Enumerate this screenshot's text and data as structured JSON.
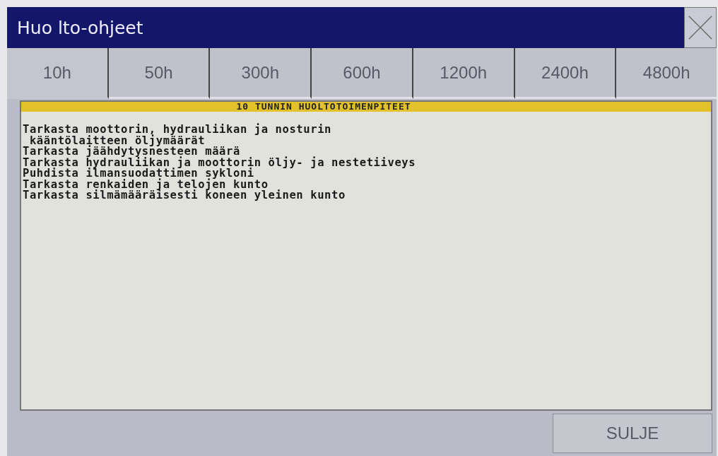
{
  "window": {
    "title": "Huo lto-ohjeet"
  },
  "tabs": [
    {
      "label": "10h",
      "selected": true
    },
    {
      "label": "50h",
      "selected": false
    },
    {
      "label": "300h",
      "selected": false
    },
    {
      "label": "600h",
      "selected": false
    },
    {
      "label": "1200h",
      "selected": false
    },
    {
      "label": "2400h",
      "selected": false
    },
    {
      "label": "4800h",
      "selected": false
    }
  ],
  "panel": {
    "heading": "10 TUNNIN HUOLTOTOIMENPITEET",
    "lines": [
      "Tarkasta moottorin, hydrauliikan ja nosturin",
      " kääntölaitteen öljymäärät",
      "Tarkasta jäähdytysnesteen määrä",
      "Tarkasta hydrauliikan ja moottorin öljy- ja nestetiiveys",
      "Puhdista ilmansuodattimen sykloni",
      "Tarkasta renkaiden ja telojen kunto",
      "Tarkasta silmämääräisesti koneen yleinen kunto"
    ]
  },
  "buttons": [
    "SULJE"
  ]
}
